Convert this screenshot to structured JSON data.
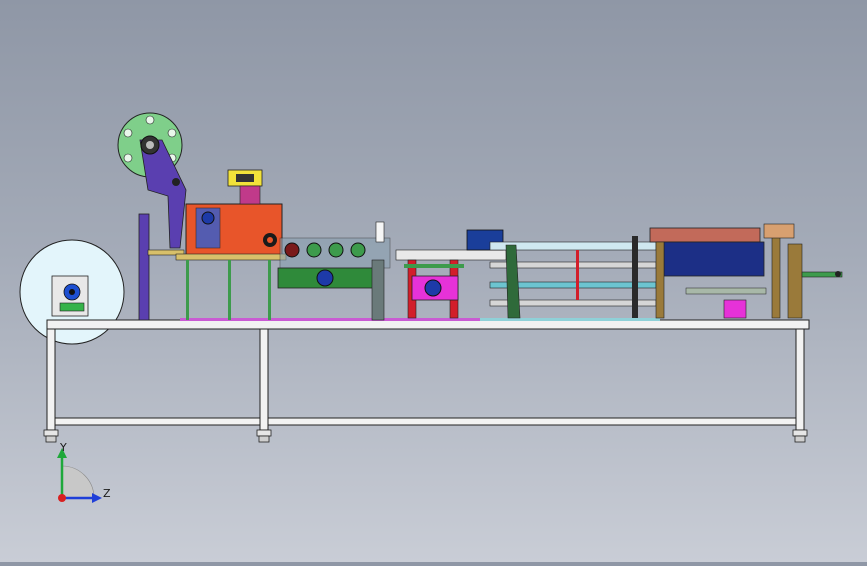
{
  "viewport": {
    "triad": {
      "y_label": "Y",
      "z_label": "Z"
    }
  },
  "colors": {
    "background_top": "#8f97a6",
    "background_bottom": "#c9cdd6",
    "frame": "#f2f2f2",
    "outline": "#202020",
    "orange_unit": "#e8552a",
    "purple_arm": "#5a3fb0",
    "green_reel": "#7fcf8a",
    "blue_reel": "#dff3fb",
    "magenta_unit": "#e632d8",
    "red_frame": "#d21e2a",
    "dark_green": "#2f8a3a"
  },
  "icons": [
    "coordinate-triad-icon"
  ]
}
